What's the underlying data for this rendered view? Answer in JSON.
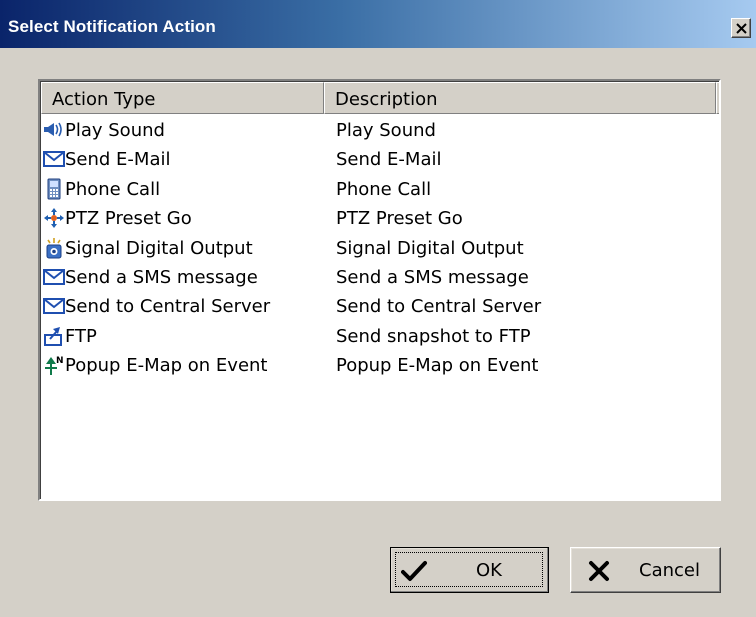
{
  "window": {
    "title": "Select Notification Action"
  },
  "list": {
    "columns": [
      "Action Type",
      "Description"
    ],
    "rows": [
      {
        "icon": "speaker-icon",
        "action": "Play Sound",
        "description": "Play Sound"
      },
      {
        "icon": "envelope-icon",
        "action": "Send E-Mail",
        "description": "Send E-Mail"
      },
      {
        "icon": "phone-icon",
        "action": "Phone Call",
        "description": "Phone Call"
      },
      {
        "icon": "ptz-arrows-icon",
        "action": "PTZ Preset Go",
        "description": "PTZ Preset Go"
      },
      {
        "icon": "digital-output-icon",
        "action": "Signal Digital Output",
        "description": "Signal Digital Output"
      },
      {
        "icon": "envelope-icon",
        "action": "Send a SMS message",
        "description": "Send a SMS message"
      },
      {
        "icon": "envelope-icon",
        "action": "Send to Central Server",
        "description": "Send to Central Server"
      },
      {
        "icon": "upload-arrow-icon",
        "action": "FTP",
        "description": "Send snapshot to FTP"
      },
      {
        "icon": "north-arrow-icon",
        "action": "Popup E-Map on Event",
        "description": "Popup E-Map on Event"
      }
    ]
  },
  "buttons": {
    "ok": "OK",
    "cancel": "Cancel"
  }
}
